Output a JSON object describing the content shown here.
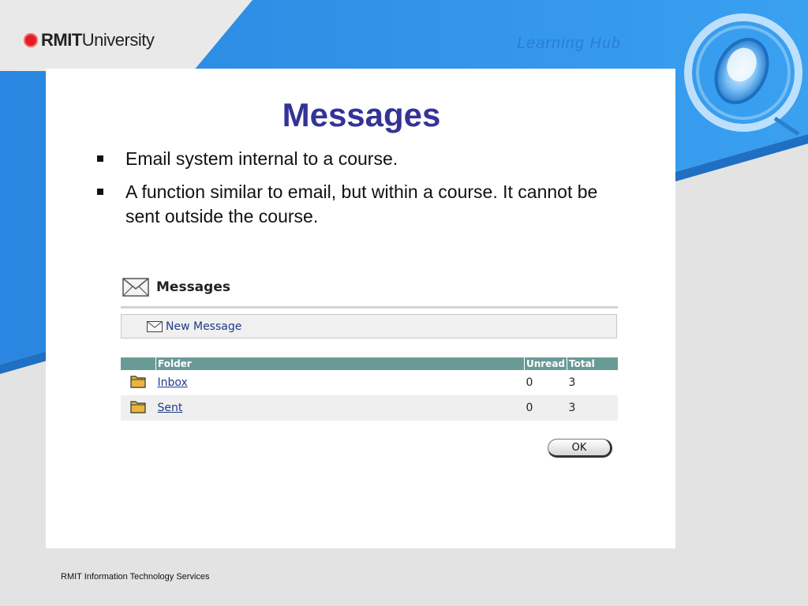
{
  "header": {
    "logo_bold": "RMIT",
    "logo_light": "University",
    "ghost_text": "Learning Hub",
    "brand_blue": "#2f8de4"
  },
  "slide": {
    "title": "Messages",
    "bullets": [
      "Email system internal to a course.",
      "A function similar to email, but within a course. It cannot be sent outside the course."
    ]
  },
  "messages": {
    "title": "Messages",
    "new_message_label": "New Message",
    "table": {
      "headers": [
        "Folder",
        "Unread",
        "Total"
      ],
      "rows": [
        {
          "folder": "Inbox",
          "unread": "0",
          "total": "3"
        },
        {
          "folder": "Sent",
          "unread": "0",
          "total": "3"
        }
      ]
    },
    "ok_label": "OK"
  },
  "footer": {
    "text": "RMIT Information Technology Services"
  }
}
